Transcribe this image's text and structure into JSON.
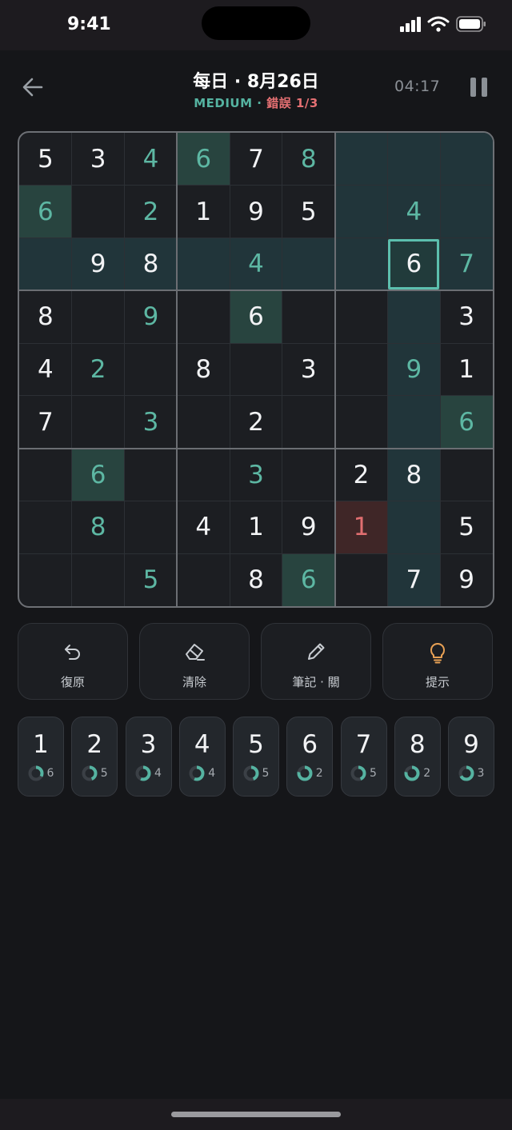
{
  "status_bar": {
    "time": "9:41"
  },
  "header": {
    "title": "每日 · 8月26日",
    "difficulty": "MEDIUM",
    "separator": " · ",
    "errors": "錯誤 1/3",
    "timer": "04:17"
  },
  "board": {
    "rows": [
      [
        "5",
        "3",
        "4",
        "6",
        "7",
        "8",
        "",
        "",
        ""
      ],
      [
        "6",
        "",
        "2",
        "1",
        "9",
        "5",
        "",
        "4",
        ""
      ],
      [
        "",
        "9",
        "8",
        "",
        "4",
        "",
        "",
        "6",
        "7"
      ],
      [
        "8",
        "",
        "9",
        "",
        "6",
        "",
        "",
        "",
        "3"
      ],
      [
        "4",
        "2",
        "",
        "8",
        "",
        "3",
        "",
        "9",
        "1"
      ],
      [
        "7",
        "",
        "3",
        "",
        "2",
        "",
        "",
        "",
        "6"
      ],
      [
        "",
        "6",
        "",
        "",
        "3",
        "",
        "2",
        "8",
        ""
      ],
      [
        "",
        "8",
        "",
        "4",
        "1",
        "9",
        "1",
        "",
        "5"
      ],
      [
        "",
        "",
        "5",
        "",
        "8",
        "6",
        "",
        "7",
        "9"
      ]
    ],
    "user_entered": [
      [
        0,
        2
      ],
      [
        0,
        3
      ],
      [
        0,
        5
      ],
      [
        1,
        0
      ],
      [
        1,
        2
      ],
      [
        1,
        7
      ],
      [
        2,
        4
      ],
      [
        2,
        8
      ],
      [
        3,
        2
      ],
      [
        4,
        1
      ],
      [
        4,
        7
      ],
      [
        5,
        2
      ],
      [
        5,
        8
      ],
      [
        6,
        1
      ],
      [
        6,
        4
      ],
      [
        7,
        1
      ],
      [
        7,
        6
      ],
      [
        8,
        2
      ],
      [
        8,
        5
      ]
    ],
    "selected": [
      2,
      7
    ],
    "error_cells": [
      [
        7,
        6
      ]
    ],
    "same_value_cells": [
      [
        0,
        3
      ],
      [
        1,
        0
      ],
      [
        3,
        4
      ],
      [
        5,
        8
      ],
      [
        6,
        1
      ],
      [
        8,
        5
      ]
    ]
  },
  "actions": [
    {
      "label": "復原",
      "icon": "undo-icon"
    },
    {
      "label": "清除",
      "icon": "eraser-icon"
    },
    {
      "label": "筆記 · 關",
      "icon": "pencil-icon"
    },
    {
      "label": "提示",
      "icon": "lightbulb-icon"
    }
  ],
  "numpad": [
    {
      "digit": "1",
      "remaining": "6",
      "progress": 0.33
    },
    {
      "digit": "2",
      "remaining": "5",
      "progress": 0.44
    },
    {
      "digit": "3",
      "remaining": "4",
      "progress": 0.56
    },
    {
      "digit": "4",
      "remaining": "4",
      "progress": 0.56
    },
    {
      "digit": "5",
      "remaining": "5",
      "progress": 0.44
    },
    {
      "digit": "6",
      "remaining": "2",
      "progress": 0.78
    },
    {
      "digit": "7",
      "remaining": "5",
      "progress": 0.44
    },
    {
      "digit": "8",
      "remaining": "2",
      "progress": 0.78
    },
    {
      "digit": "9",
      "remaining": "3",
      "progress": 0.67
    }
  ],
  "colors": {
    "accent": "#55b3a1",
    "error": "#e57073",
    "hint": "#e8a155"
  }
}
